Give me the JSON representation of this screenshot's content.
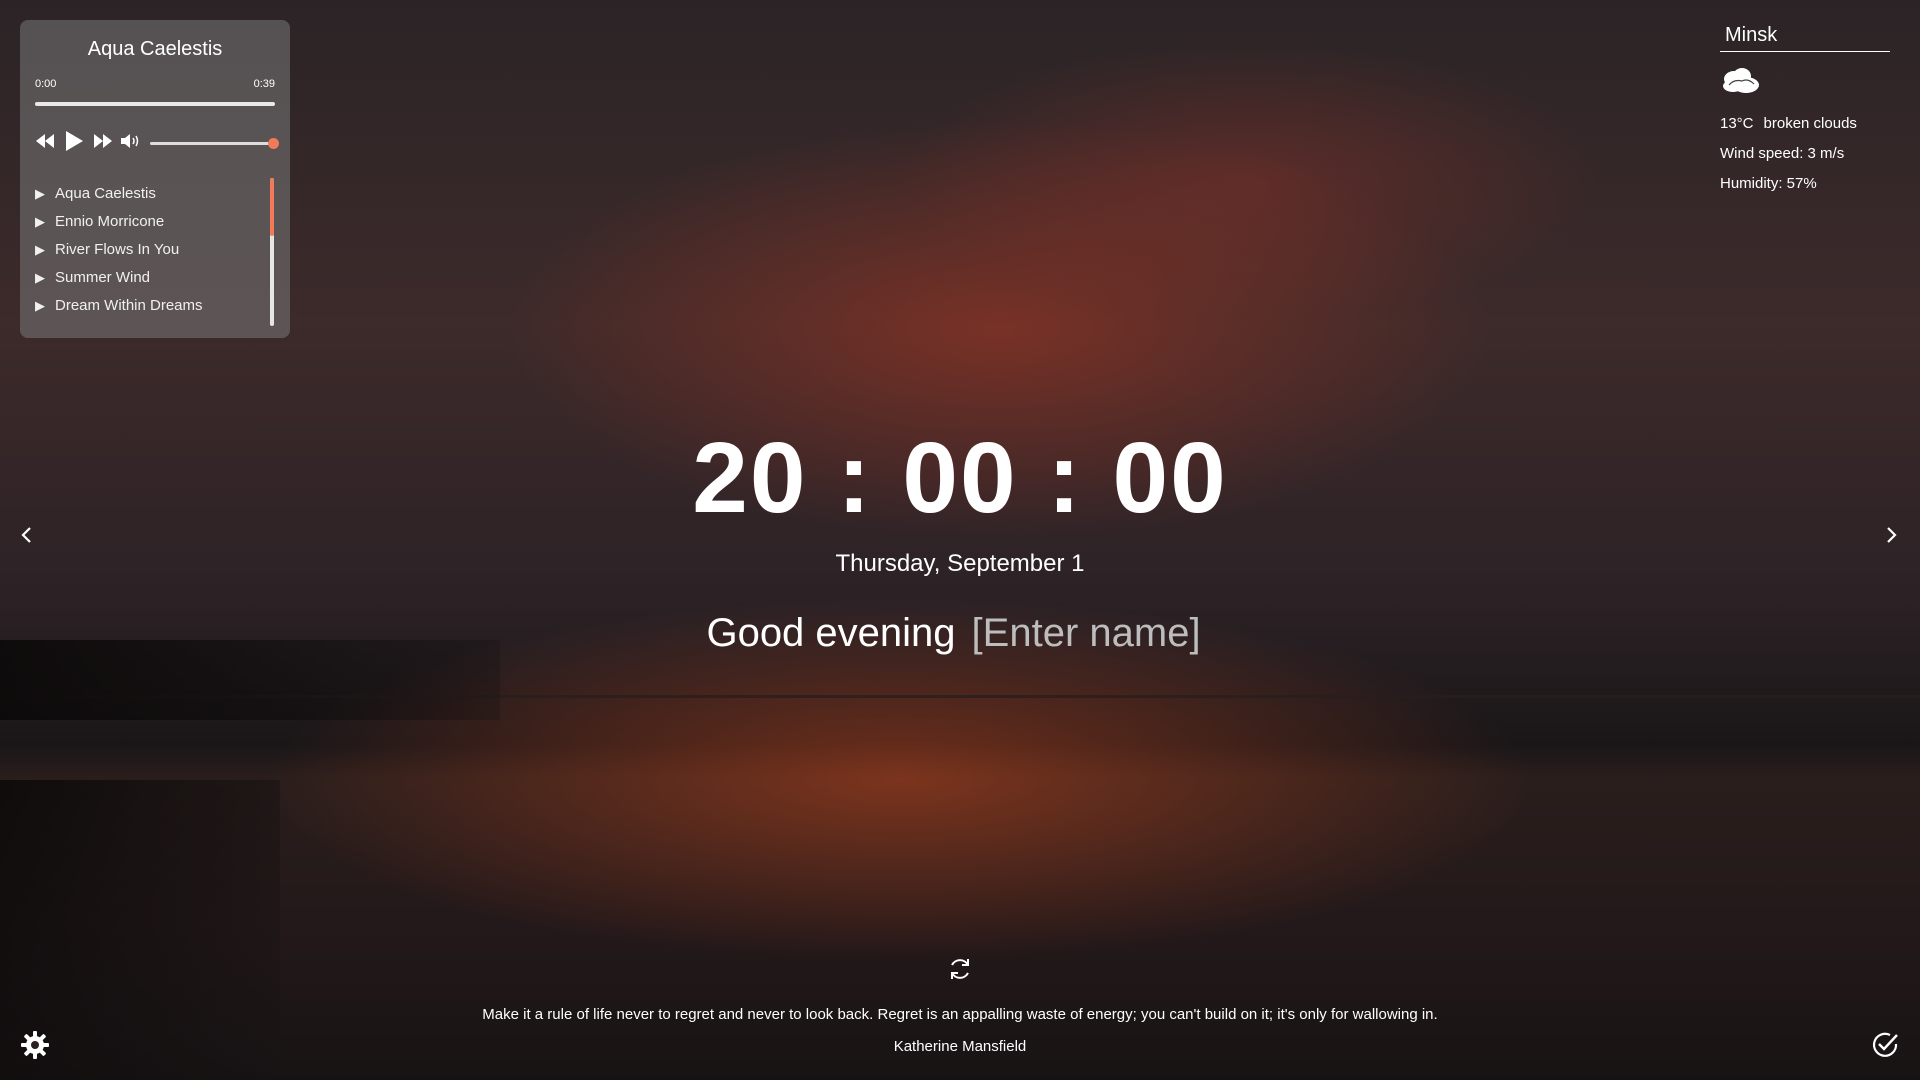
{
  "player": {
    "title": "Aqua Caelestis",
    "current_time": "0:00",
    "duration": "0:39",
    "progress": 0,
    "volume": 1.0,
    "playlist": [
      {
        "label": "Aqua Caelestis"
      },
      {
        "label": "Ennio Morricone"
      },
      {
        "label": "River Flows In You"
      },
      {
        "label": "Summer Wind"
      },
      {
        "label": "Dream Within Dreams"
      }
    ],
    "icons": [
      "rewind-icon",
      "play-icon",
      "fast-forward-icon",
      "volume-icon"
    ],
    "accent_color": "#f07a5a"
  },
  "weather": {
    "city": "Minsk",
    "icon": "broken-clouds-icon",
    "temperature": "13°C",
    "description": "broken clouds",
    "wind": "Wind speed: 3 m/s",
    "humidity": "Humidity: 57%"
  },
  "clock": {
    "time": "20 : 00 : 00"
  },
  "date": "Thursday, September 1",
  "greeting": {
    "text": "Good evening",
    "name_placeholder": "[Enter name]"
  },
  "quote": {
    "text": "Make it a rule of life never to regret and never to look back. Regret is an appalling waste of energy; you can't build on it; it's only for wallowing in.",
    "author": "Katherine Mansfield"
  },
  "icons": {
    "prev": "chevron-left-icon",
    "next": "chevron-right-icon",
    "refresh": "refresh-icon",
    "settings": "gear-icon",
    "todo": "check-circle-icon"
  }
}
